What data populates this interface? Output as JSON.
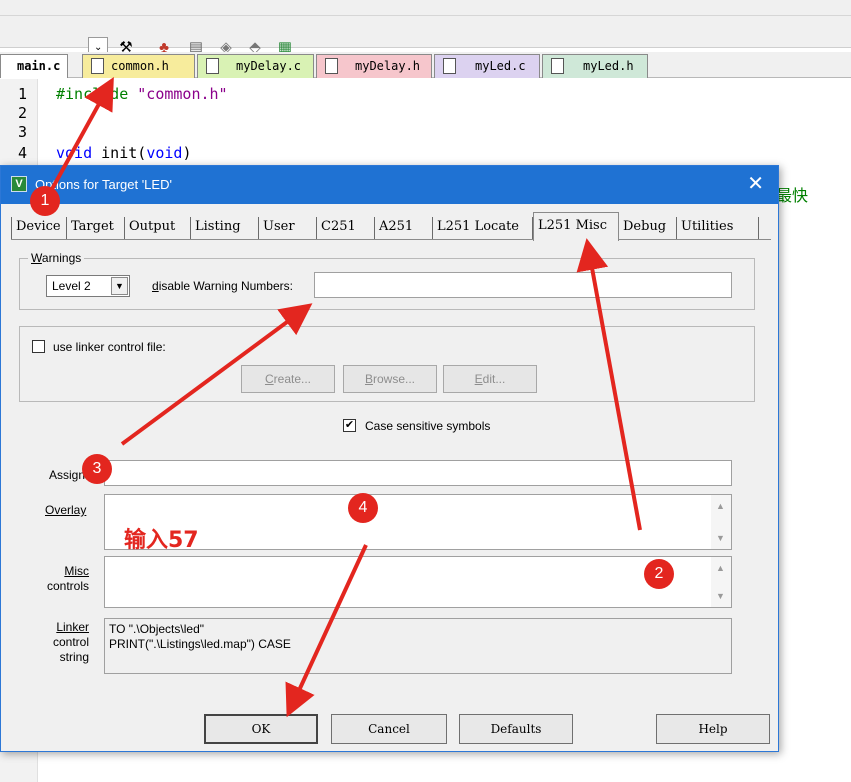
{
  "ide": {
    "toolbar_icons": [
      "magic-wand-icon",
      "target-options-icon",
      "layers-icon",
      "diamond-icon",
      "download-icon",
      "chip-icon"
    ],
    "tabs": [
      {
        "label": "main.c",
        "color": "#ffffff"
      },
      {
        "label": "common.h",
        "color": "#f7ec9c"
      },
      {
        "label": "myDelay.c",
        "color": "#d9f2b4"
      },
      {
        "label": "myDelay.h",
        "color": "#f6c6cc"
      },
      {
        "label": "myLed.c",
        "color": "#dcd2f0"
      },
      {
        "label": "myLed.h",
        "color": "#cfe8d8"
      }
    ],
    "line_numbers": [
      "1",
      "2",
      "3",
      "4"
    ],
    "code": {
      "line1_pp": "#include",
      "line1_str": " \"common.h\"",
      "line4_kw1": "void",
      "line4_mid": " init(",
      "line4_kw2": "void",
      "line4_end": ")"
    },
    "behind_dialog_text": "最快"
  },
  "dialog": {
    "title": "Options for Target 'LED'",
    "close_glyph": "✕",
    "tabs": [
      "Device",
      "Target",
      "Output",
      "Listing",
      "User",
      "C251",
      "A251",
      "L251 Locate",
      "L251 Misc",
      "Debug",
      "Utilities"
    ],
    "selected_tab": "L251 Misc",
    "warnings": {
      "legend_first": "W",
      "legend_rest": "arnings",
      "level": "Level 2",
      "disable_label_pre": "d",
      "disable_label_rest": "isable Warning Numbers:",
      "disable_value": ""
    },
    "linker_file": {
      "checkbox_label": "use linker control file:",
      "checked": false,
      "create_first": "C",
      "create_rest": "reate...",
      "browse_first": "B",
      "browse_rest": "rowse...",
      "edit_first": "E",
      "edit_rest": "dit..."
    },
    "case_sensitive": {
      "label": "Case sensitive symbols",
      "checked": true
    },
    "assign_label": "Assign",
    "overlay_label": "Overlay",
    "misc_label_1": "Misc",
    "misc_label_2": "controls",
    "linker_label_1": "Linker",
    "linker_label_2": "control",
    "linker_label_3": "string",
    "linker_string": "TO \".\\Objects\\led\"\nPRINT(\".\\Listings\\led.map\") CASE",
    "buttons": {
      "ok": "OK",
      "cancel": "Cancel",
      "defaults": "Defaults",
      "help": "Help"
    }
  },
  "annotations": {
    "badges": [
      "1",
      "2",
      "3",
      "4"
    ],
    "note": "输入57",
    "color": "#e3261f"
  }
}
